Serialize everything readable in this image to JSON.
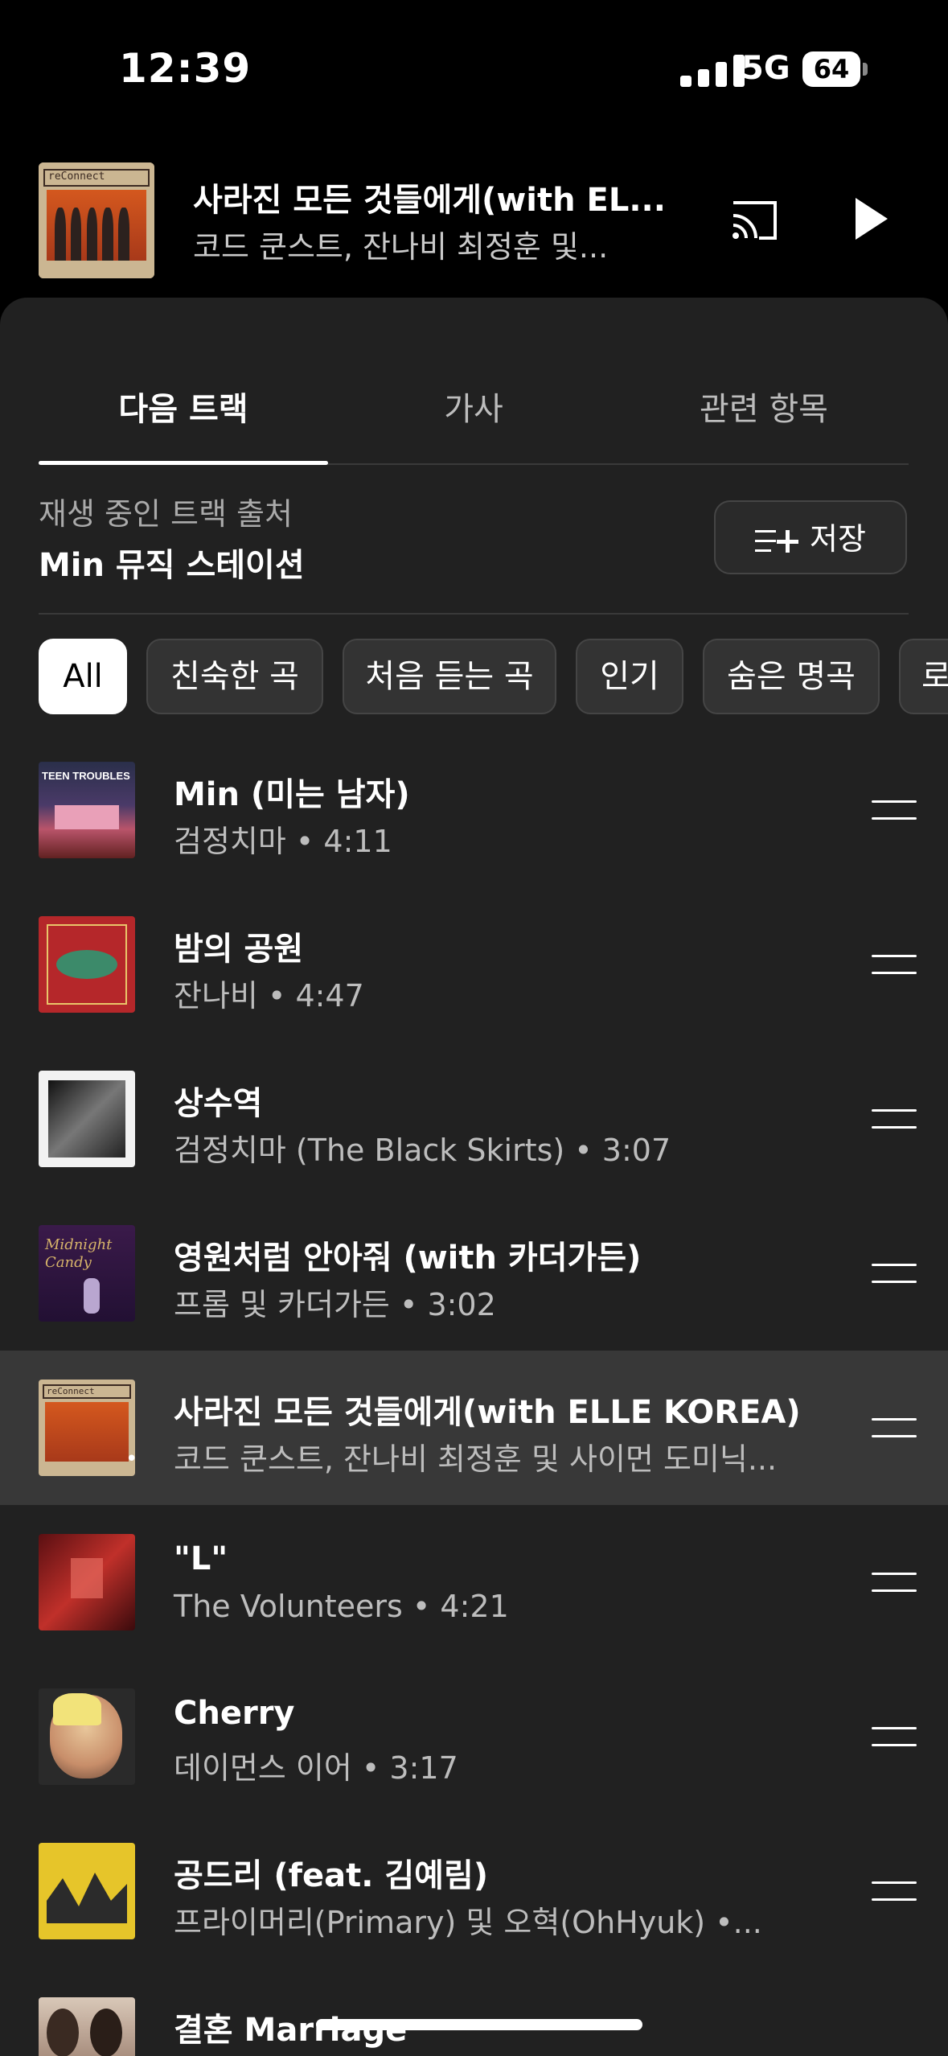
{
  "status_bar": {
    "time": "12:39",
    "network": "5G",
    "battery": "64"
  },
  "mini_player": {
    "title": "사라진 모든 것들에게(with EL...",
    "artist": "코드 쿤스트, 잔나비 최정훈 및...",
    "art_label": "reConnect",
    "icons": {
      "cast": "cast-icon",
      "play": "play-icon"
    }
  },
  "tabs": [
    {
      "label": "다음 트랙",
      "active": true
    },
    {
      "label": "가사",
      "active": false
    },
    {
      "label": "관련 항목",
      "active": false
    }
  ],
  "source": {
    "label": "재생 중인 트랙 출처",
    "name": "Min 뮤직 스테이션"
  },
  "save_button": {
    "icon": "playlist-add-icon",
    "label": "저장"
  },
  "chips": [
    "All",
    "친숙한 곡",
    "처음 듣는 곡",
    "인기",
    "숨은 명곡",
    "로"
  ],
  "selected_chip": "All",
  "tracks": [
    {
      "title": "Min (미는 남자)",
      "subtitle": "검정치마 • 4:11",
      "art_label": "TEEN TROUBLES"
    },
    {
      "title": "밤의 공원",
      "subtitle": "잔나비 • 4:47"
    },
    {
      "title": "상수역",
      "subtitle": "검정치마 (The Black Skirts) • 3:07"
    },
    {
      "title": "영원처럼 안아줘 (with 카더가든)",
      "subtitle": "프롬 및 카더가든 • 3:02",
      "art_label": "Midnight Candy"
    },
    {
      "title": "사라진 모든 것들에게(with ELLE KOREA)",
      "subtitle": "코드 쿤스트, 잔나비 최정훈 및 사이먼 도미닉...",
      "now_playing": true,
      "art_label": "reConnect"
    },
    {
      "title": "\"L\"",
      "subtitle": "The Volunteers • 4:21"
    },
    {
      "title": "Cherry",
      "subtitle": "데이먼스 이어 • 3:17"
    },
    {
      "title": "공드리 (feat. 김예림)",
      "subtitle": "프라이머리(Primary) 및 오혁(OhHyuk) •..."
    },
    {
      "title": "결혼 Marriage",
      "subtitle": ""
    }
  ]
}
